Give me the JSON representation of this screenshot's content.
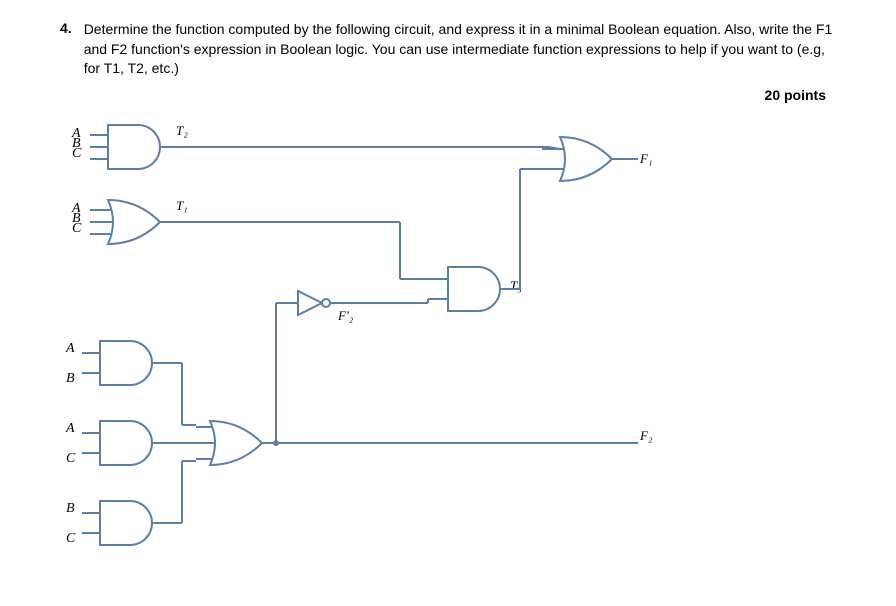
{
  "question": {
    "number": "4.",
    "text": "Determine the function computed by the following circuit, and express it in a minimal Boolean equation. Also, write the F1 and F2 function's expression in Boolean logic. You can use intermediate function expressions to help if you want to (e.g, for T1, T2, etc.)",
    "points": "20 points"
  },
  "diagram": {
    "inputs": {
      "gate1": {
        "a": "A",
        "b": "B",
        "c": "C"
      },
      "gate2": {
        "a": "A",
        "b": "B",
        "c": "C"
      },
      "gate3": {
        "a": "A",
        "b": "B"
      },
      "gate4": {
        "a": "A",
        "c": "C"
      },
      "gate5": {
        "b": "B",
        "c": "C"
      }
    },
    "nodes": {
      "T1": "T₁",
      "T2": "T₂",
      "T3": "T₃",
      "F1": "F₁",
      "F2": "F₂",
      "F2prime": "F'₂"
    }
  }
}
